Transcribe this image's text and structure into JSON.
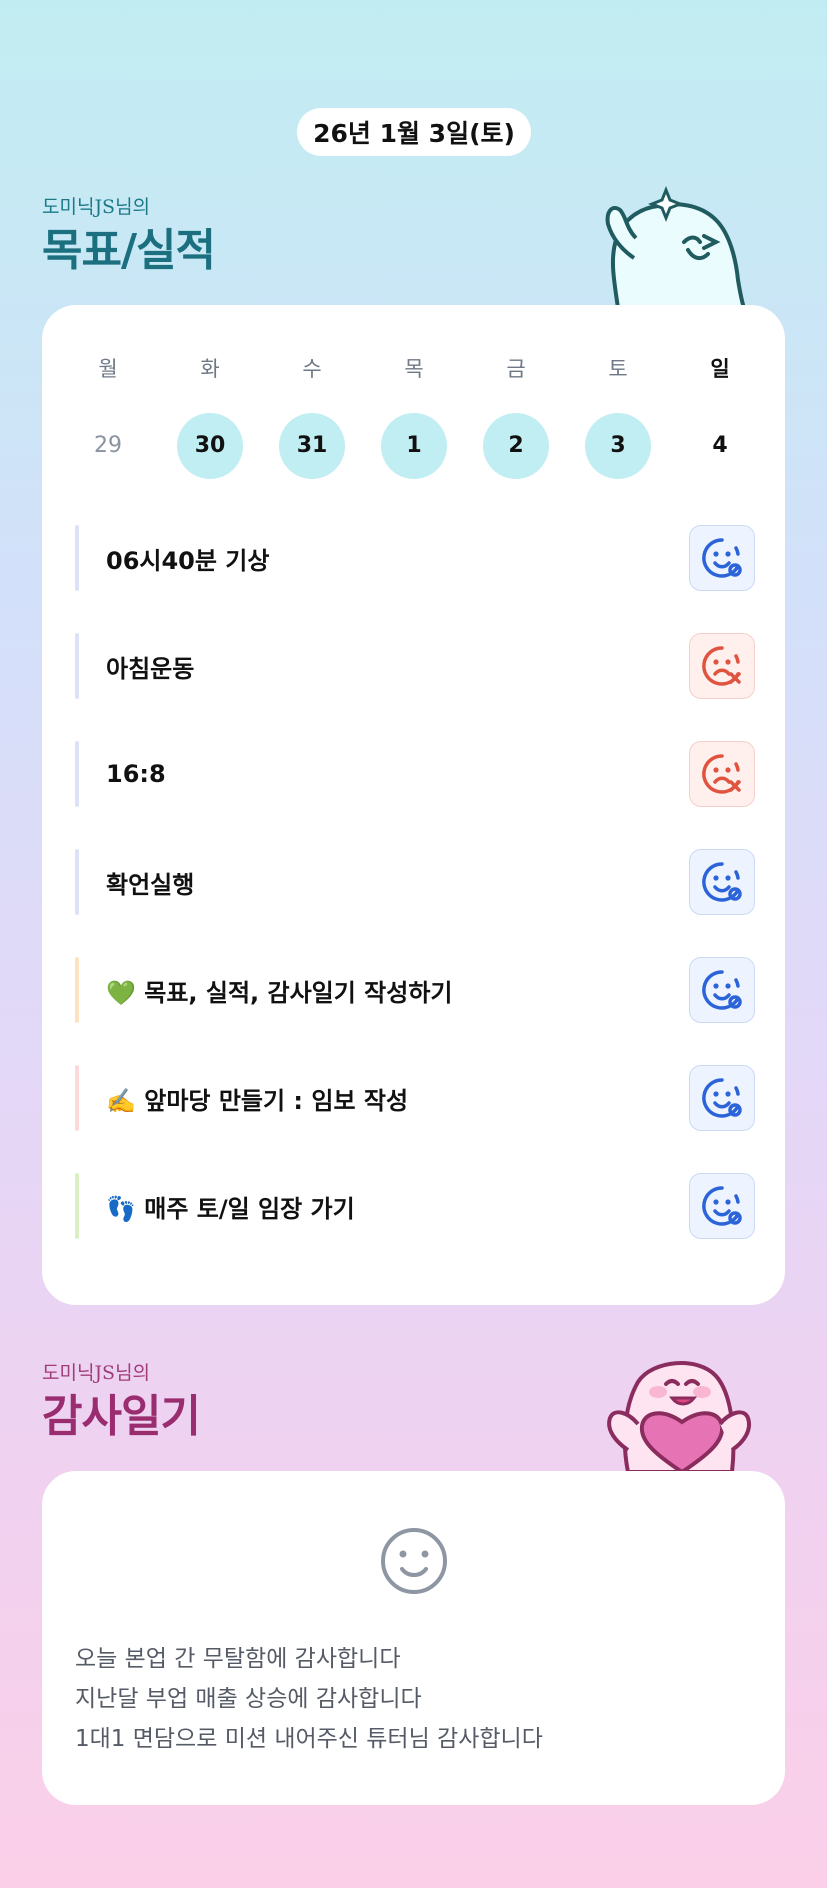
{
  "header": {
    "date": "26년 1월 3일(토)"
  },
  "goals_section": {
    "subtitle": "도미닉JS님의",
    "title": "목표/실적"
  },
  "week": {
    "labels": [
      "월",
      "화",
      "수",
      "목",
      "금",
      "토",
      "일"
    ],
    "dates": [
      "29",
      "30",
      "31",
      "1",
      "2",
      "3",
      "4"
    ]
  },
  "goals": [
    {
      "text": "06시40분 기상",
      "status": "success",
      "bar_color": "#dce3f9"
    },
    {
      "text": "아침운동",
      "status": "fail",
      "bar_color": "#dce3f9"
    },
    {
      "text": "16:8",
      "status": "fail",
      "bar_color": "#dce3f9"
    },
    {
      "text": "확언실행",
      "status": "success",
      "bar_color": "#dce3f9"
    },
    {
      "text": "💚 목표, 실적, 감사일기 작성하기",
      "status": "success",
      "bar_color": "#fde2c4"
    },
    {
      "text": "✍️ 앞마당 만들기 : 임보 작성",
      "status": "success",
      "bar_color": "#fcdada"
    },
    {
      "text": "👣 매주 토/일 임장 가기",
      "status": "success",
      "bar_color": "#d8f0c2"
    }
  ],
  "gratitude_section": {
    "subtitle": "도미닉JS님의",
    "title": "감사일기"
  },
  "gratitude": {
    "lines": [
      "오늘 본업 간 무탈함에 감사합니다",
      "지난달 부업 매출 상승에 감사합니다",
      "1대1 면담으로 미션 내어주신 튜터님 감사합니다"
    ]
  },
  "icons": {
    "success": "smile-ok-icon",
    "fail": "frown-x-icon",
    "gratitude": "smiley-icon"
  },
  "colors": {
    "success": "#2b63d9",
    "fail": "#e0533f",
    "highlight_day": "#c0eef2",
    "goals_title": "#1b6f7e",
    "gratitude_title": "#9a2c70"
  }
}
